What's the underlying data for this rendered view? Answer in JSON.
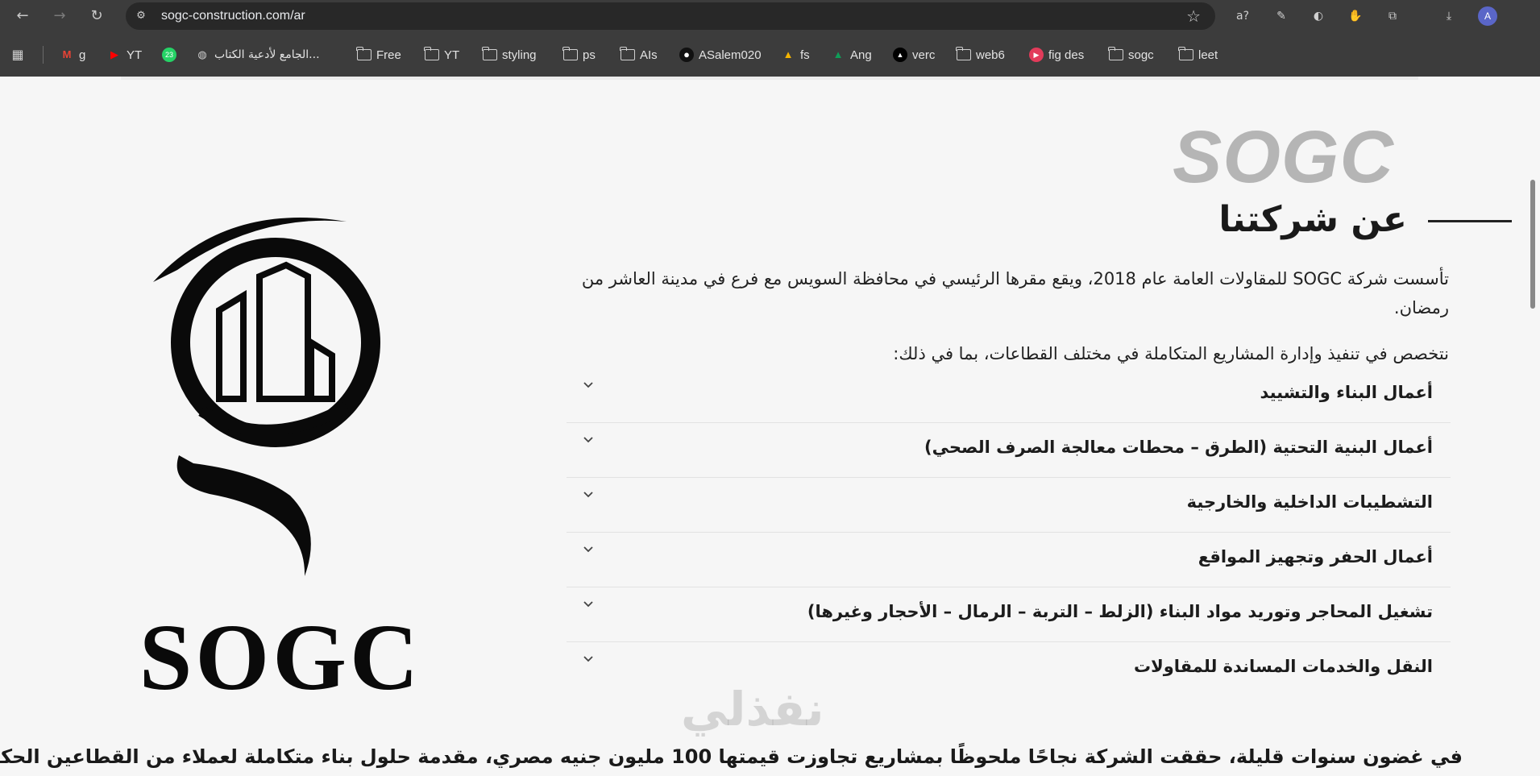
{
  "browser": {
    "url": "sogc-construction.com/ar",
    "profile_initial": "A",
    "extensions": [
      "translate-icon",
      "eyedropper-icon",
      "circle-ext-icon",
      "hand-ext-icon",
      "puzzle-icon"
    ]
  },
  "bookmarks": [
    {
      "label": "g",
      "icon": "gmail-icon"
    },
    {
      "label": "YT",
      "icon": "youtube-icon"
    },
    {
      "label": "",
      "icon": "whatsapp-icon",
      "badge": "23"
    },
    {
      "label": "الجامع لأدعية الكتاب...",
      "icon": "globe-icon"
    },
    {
      "label": "Free",
      "icon": "folder-icon"
    },
    {
      "label": "YT",
      "icon": "folder-icon"
    },
    {
      "label": "styling",
      "icon": "folder-icon"
    },
    {
      "label": "ps",
      "icon": "folder-icon"
    },
    {
      "label": "AIs",
      "icon": "folder-icon"
    },
    {
      "label": "ASalem020",
      "icon": "github-icon"
    },
    {
      "label": "fs",
      "icon": "drive-icon"
    },
    {
      "label": "Ang",
      "icon": "drive-icon"
    },
    {
      "label": "verc",
      "icon": "vercel-icon"
    },
    {
      "label": "web6",
      "icon": "folder-icon"
    },
    {
      "label": "fig des",
      "icon": "figma-icon"
    },
    {
      "label": "sogc",
      "icon": "folder-icon"
    },
    {
      "label": "leet",
      "icon": "folder-icon"
    }
  ],
  "page": {
    "bg_brand": "SOGC",
    "section_title": "عن شركتنا",
    "intro": "تأسست شركة SOGC للمقاولات العامة عام 2018، ويقع مقرها الرئيسي في محافظة السويس مع فرع في مدينة العاشر من رمضان.",
    "lead": "نتخصص في تنفيذ وإدارة المشاريع المتكاملة في مختلف القطاعات، بما في ذلك:",
    "services": [
      "أعمال البناء والتشييد",
      "أعمال البنية التحتية (الطرق – محطات معالجة الصرف الصحي)",
      "التشطيبات الداخلية والخارجية",
      "أعمال الحفر وتجهيز المواقع",
      "تشغيل المحاجر وتوريد مواد البناء (الزلط – التربة – الرمال – الأحجار وغيرها)",
      "النقل والخدمات المساندة للمقاولات"
    ],
    "logo_text": "SOGC",
    "bottom_text": "في غضون سنوات قليلة، حققت الشركة نجاحًا ملحوظًا بمشاريع تجاوزت قيمتها 100 مليون جنيه مصري، مقدمة حلول بناء متكاملة لعملاء من القطاعين الحكومي والخاص.",
    "watermark": "نفذلي"
  }
}
